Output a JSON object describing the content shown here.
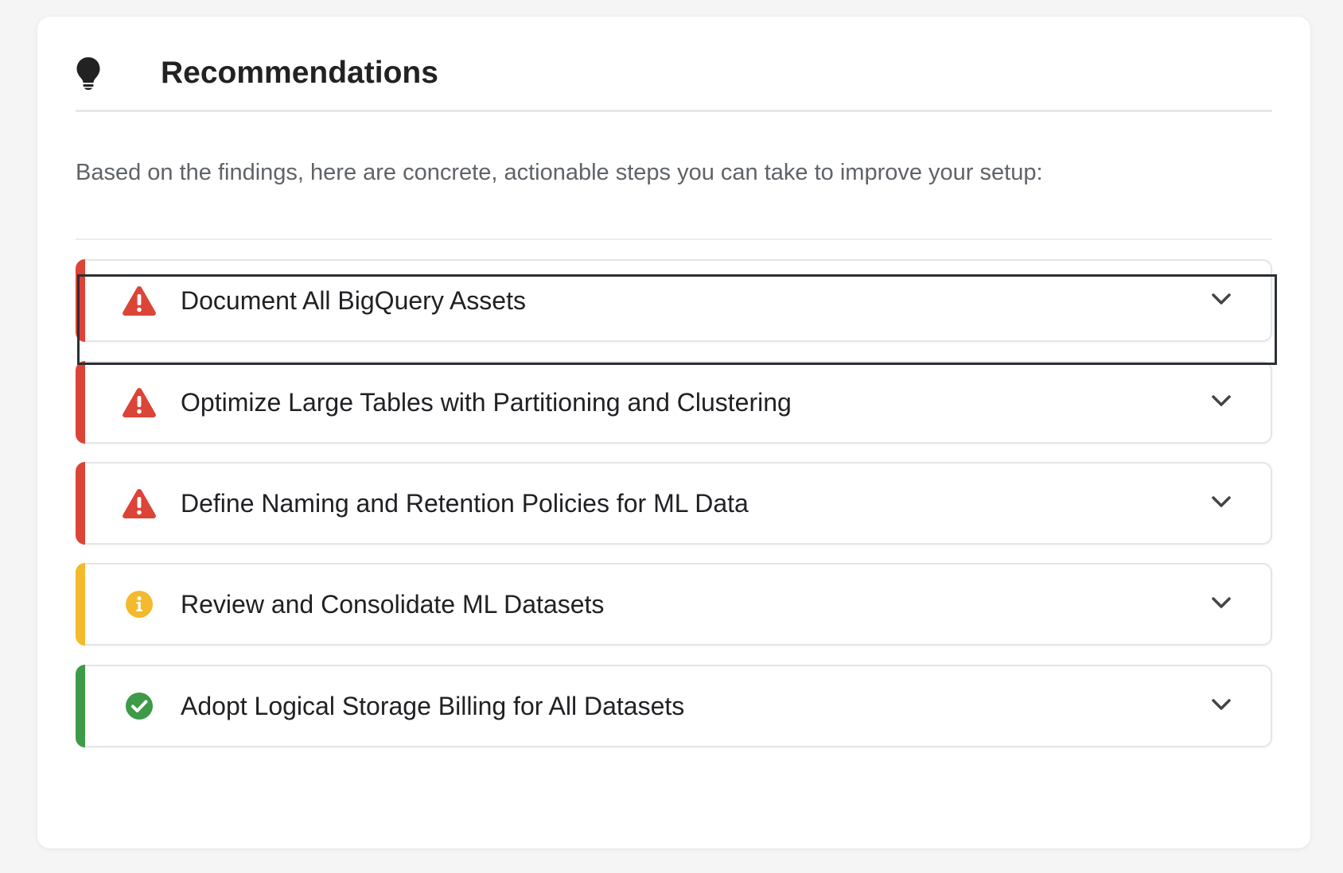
{
  "header": {
    "icon": "lightbulb-icon",
    "title": "Recommendations"
  },
  "intro": "Based on the findings, here are concrete, actionable steps you can take to improve your setup:",
  "colors": {
    "high": "#dc4437",
    "medium": "#f4b92d",
    "low": "#3d9a47"
  },
  "recommendations": [
    {
      "title": "Document All BigQuery Assets",
      "severity": "high",
      "icon": "warning-icon",
      "expand_icon": "chevron-down-icon"
    },
    {
      "title": "Optimize Large Tables with Partitioning and Clustering",
      "severity": "high",
      "icon": "warning-icon",
      "expand_icon": "chevron-down-icon"
    },
    {
      "title": "Define Naming and Retention Policies for ML Data",
      "severity": "high",
      "icon": "warning-icon",
      "expand_icon": "chevron-down-icon"
    },
    {
      "title": "Review and Consolidate ML Datasets",
      "severity": "medium",
      "icon": "info-icon",
      "expand_icon": "chevron-down-icon"
    },
    {
      "title": "Adopt Logical Storage Billing for All Datasets",
      "severity": "low",
      "icon": "check-circle-icon",
      "expand_icon": "chevron-down-icon"
    }
  ]
}
